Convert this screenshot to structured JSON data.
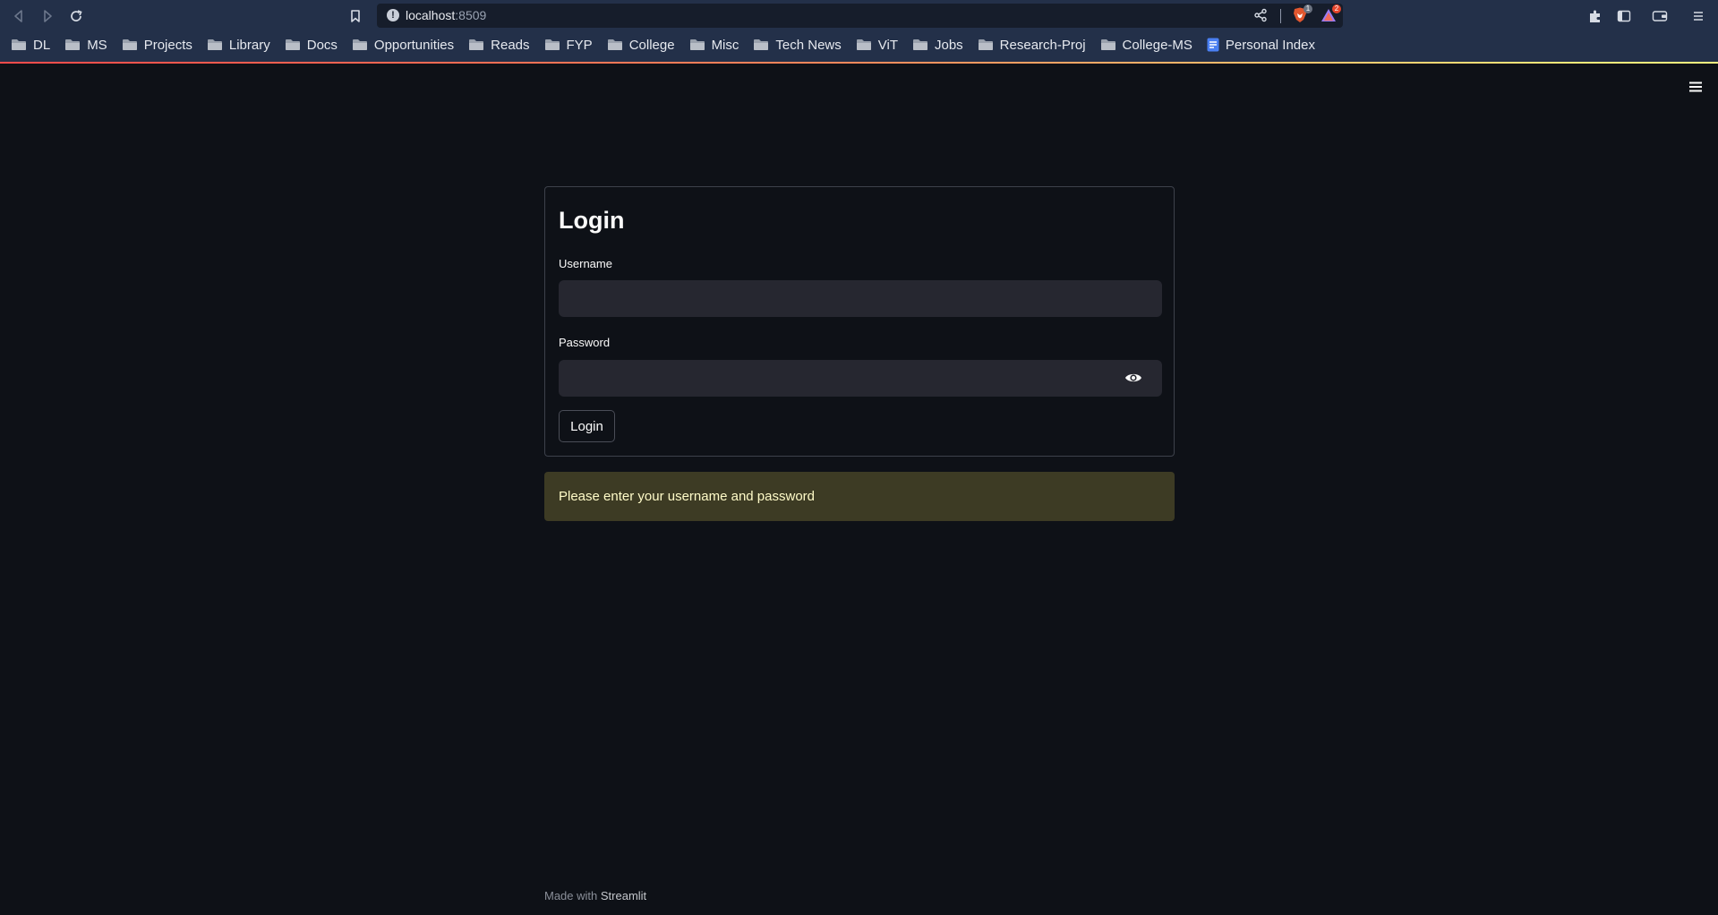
{
  "browser": {
    "url_host": "localhost",
    "url_port": ":8509",
    "shield_badge": "1",
    "rewards_badge": "2",
    "bookmarks": [
      {
        "label": "DL",
        "icon": "folder-icon"
      },
      {
        "label": "MS",
        "icon": "folder-icon"
      },
      {
        "label": "Projects",
        "icon": "folder-icon"
      },
      {
        "label": "Library",
        "icon": "folder-icon"
      },
      {
        "label": "Docs",
        "icon": "folder-icon"
      },
      {
        "label": "Opportunities",
        "icon": "folder-icon"
      },
      {
        "label": "Reads",
        "icon": "folder-icon"
      },
      {
        "label": "FYP",
        "icon": "folder-icon"
      },
      {
        "label": "College",
        "icon": "folder-icon"
      },
      {
        "label": "Misc",
        "icon": "folder-icon"
      },
      {
        "label": "Tech News",
        "icon": "folder-icon"
      },
      {
        "label": "ViT",
        "icon": "folder-icon"
      },
      {
        "label": "Jobs",
        "icon": "folder-icon"
      },
      {
        "label": "Research-Proj",
        "icon": "folder-icon"
      },
      {
        "label": "College-MS",
        "icon": "folder-icon"
      },
      {
        "label": "Personal Index",
        "icon": "google-docs-icon"
      }
    ]
  },
  "form": {
    "title": "Login",
    "username_label": "Username",
    "username_value": "",
    "password_label": "Password",
    "password_value": "",
    "submit_label": "Login"
  },
  "alert": {
    "message": "Please enter your username and password"
  },
  "footer": {
    "prefix": "Made with",
    "brand": "Streamlit"
  },
  "colors": {
    "page_bg": "#0e1117",
    "chrome_bg": "#233049",
    "input_bg": "#262730",
    "alert_bg": "#3d3b24",
    "alert_text": "#fffbc8"
  }
}
